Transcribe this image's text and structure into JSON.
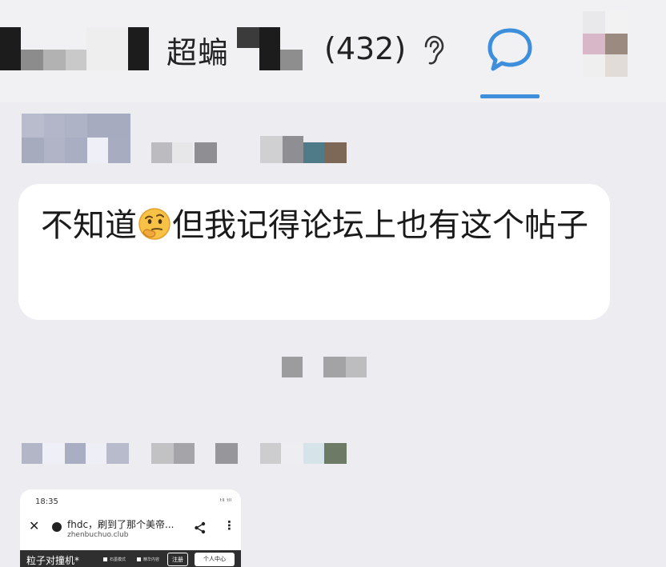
{
  "header": {
    "group_name": "超蝙",
    "member_count": "(432)",
    "icons": [
      "ear-icon",
      "chat-bubble-icon",
      "avatar"
    ],
    "accent_color": "#3d8fdc"
  },
  "messages": [
    {
      "type": "text",
      "text_before_emoji": "不知道",
      "emoji": "thinking-face",
      "text_after_emoji": "但我记得论坛上也有这个帖子"
    }
  ],
  "shared_image": {
    "status_time": "18:35",
    "status_signal": "ᵗˡˡ ᵗˡˡ",
    "page_title": "fhdc，刷到了那个美帝...",
    "domain": "zhenbuchuo.club",
    "site_name": "粒子对撞机*",
    "nav_items": [
      "石墨模式",
      "精华内容"
    ],
    "register_label": "注册",
    "user_center_label": "个人中心"
  },
  "colors": {
    "page_bg": "#ededf1",
    "bubble_bg": "#ffffff",
    "text": "#1a1a1a"
  }
}
